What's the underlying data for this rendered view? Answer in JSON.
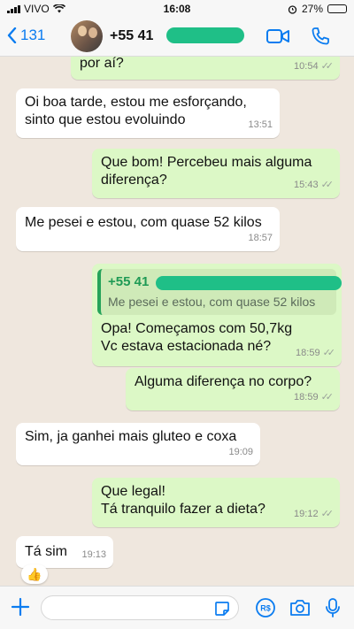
{
  "status_bar": {
    "carrier": "VIVO",
    "time": "16:08",
    "battery": "27%",
    "battery_level": 0.27
  },
  "header": {
    "back_count": "131",
    "contact_name": "+55 41"
  },
  "messages": [
    {
      "text": "por aí?",
      "time": "10:54",
      "direction": "out"
    },
    {
      "text": "Oi boa tarde, estou me esforçando, sinto que estou evoluindo",
      "line1": "Oi boa tarde, estou me esforçando,",
      "line2": "sinto que estou evoluindo",
      "time": "13:51",
      "direction": "in"
    },
    {
      "line1": "Que bom! Percebeu mais alguma",
      "line2": "diferença?",
      "time": "15:43",
      "direction": "out"
    },
    {
      "text": "Me pesei e estou, com quase 52 kilos",
      "time": "18:57",
      "direction": "in"
    },
    {
      "quote_name": "+55 41",
      "quote_text": "Me pesei e estou, com quase 52 kilos",
      "line1": "Opa! Começamos com 50,7kg",
      "line2": "Vc estava estacionada né?",
      "time": "18:59",
      "direction": "out"
    },
    {
      "text": "Alguma diferença no corpo?",
      "time": "18:59",
      "direction": "out"
    },
    {
      "text": "Sim, ja ganhei mais gluteo e coxa",
      "time": "19:09",
      "direction": "in"
    },
    {
      "line1": "Que legal!",
      "line2": "Tá tranquilo fazer a dieta?",
      "time": "19:12",
      "direction": "out"
    },
    {
      "text": "Tá sim",
      "time": "19:13",
      "direction": "in",
      "reaction": "👍"
    }
  ],
  "colors": {
    "accent": "#0b7cf0",
    "outgoing": "#dcf8c6",
    "incoming": "#ffffff",
    "background": "#efe7de",
    "redaction": "#1fbf87"
  },
  "icons": {
    "back": "chevron-left-icon",
    "video": "video-camera-icon",
    "call": "phone-icon",
    "plus": "plus-icon",
    "sticker": "sticker-icon",
    "pay": "payment-icon",
    "camera": "camera-icon",
    "mic": "microphone-icon"
  }
}
